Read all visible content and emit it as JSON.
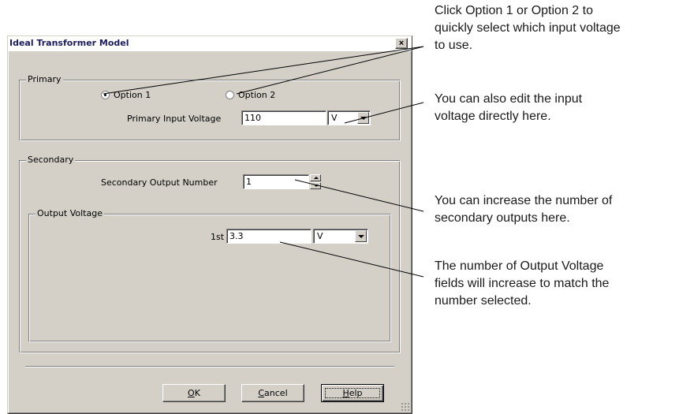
{
  "window": {
    "title": "Ideal Transformer Model",
    "close_label": "×"
  },
  "primary": {
    "group_label": "Primary",
    "option1_label": "Option 1",
    "option2_label": "Option 2",
    "option1_selected": true,
    "input_voltage_label": "Primary Input Voltage",
    "input_voltage_value": "110",
    "input_voltage_unit": "V"
  },
  "secondary": {
    "group_label": "Secondary",
    "output_number_label": "Secondary Output Number",
    "output_number_value": "1",
    "output_voltage_group_label": "Output Voltage",
    "outputs": [
      {
        "label": "1st",
        "value": "3.3",
        "unit": "V"
      }
    ]
  },
  "buttons": {
    "ok_prefix": "O",
    "ok_rest": "K",
    "cancel_prefix": "C",
    "cancel_rest": "ancel",
    "help_prefix": "H",
    "help_rest": "elp"
  },
  "callouts": {
    "options": [
      "Click Option 1 or Option 2 to",
      "quickly select which input voltage",
      "to use."
    ],
    "edit_voltage": [
      "You can also edit the input",
      "voltage directly here."
    ],
    "increase_outputs": [
      "You can increase the number of",
      "secondary outputs here."
    ],
    "fields_increase": [
      "The number of Output Voltage",
      "fields will increase to match the",
      "number selected."
    ]
  }
}
